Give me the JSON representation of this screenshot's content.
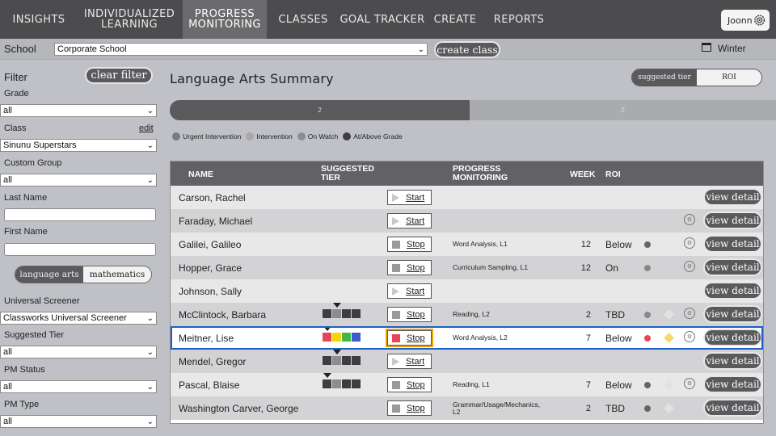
{
  "nav": {
    "items": [
      "INSIGHTS",
      "INDIVIDUALIZED\nLEARNING",
      "PROGRESS\nMONITORING",
      "CLASSES",
      "GOAL TRACKER",
      "CREATE",
      "REPORTS"
    ],
    "active": "PROGRESS\nMONITORING",
    "user": "Joonn"
  },
  "schoolbar": {
    "school_label": "School",
    "school_value": "Corporate School",
    "create_class": "create class",
    "term": "Winter"
  },
  "sidebar": {
    "filter_label": "Filter",
    "clear_filter": "clear filter",
    "grade_label": "Grade",
    "grade_value": "all",
    "class_label": "Class",
    "class_edit": "edit",
    "class_value": "Sinunu Superstars",
    "custom_group_label": "Custom Group",
    "custom_group_value": "all",
    "last_name_label": "Last Name",
    "first_name_label": "First Name",
    "subject_options": [
      "language arts",
      "mathematics"
    ],
    "subject_selected": "language arts",
    "screener_label": "Universal Screener",
    "screener_value": "Classworks Universal Screener",
    "suggested_tier_label": "Suggested Tier",
    "suggested_tier_value": "all",
    "pm_status_label": "PM Status",
    "pm_status_value": "all",
    "pm_type_label": "PM Type",
    "pm_type_value": "all"
  },
  "main": {
    "title": "Language Arts Summary",
    "view_toggle": [
      "suggested tier",
      "ROI"
    ],
    "view_selected": "ROI",
    "bar": [
      {
        "value": "2",
        "fraction": 0.495,
        "color": "#5a5a5d"
      },
      {
        "value": "2",
        "fraction": 0.505,
        "color": "#a9abaf"
      }
    ],
    "legend": [
      {
        "label": "Urgent Intervention",
        "color": "#7a7a7e"
      },
      {
        "label": "Intervention",
        "color": "#a8a8ab"
      },
      {
        "label": "On Watch",
        "color": "#8d8d90"
      },
      {
        "label": "At/Above Grade",
        "color": "#3e3e41"
      }
    ],
    "columns": {
      "name": "NAME",
      "tier": "SUGGESTED\nTIER",
      "pm": "PROGRESS\nMONITORING",
      "week": "WEEK",
      "roi": "ROI"
    },
    "view_detail_label": "view detail",
    "rows": [
      {
        "name": "Carson, Rachel",
        "tier": [],
        "tier_mark": -1,
        "pm_action": "Start",
        "pm_desc": "",
        "week": "",
        "roi": "",
        "dot": "",
        "diamond": "",
        "gear": false
      },
      {
        "name": "Faraday, Michael",
        "tier": [],
        "tier_mark": -1,
        "pm_action": "Start",
        "pm_desc": "",
        "week": "",
        "roi": "",
        "dot": "",
        "diamond": "",
        "gear": true
      },
      {
        "name": "Galilei, Galileo",
        "tier": [],
        "tier_mark": -1,
        "pm_action": "Stop",
        "pm_desc": "Word Analysis, L1",
        "week": "12",
        "roi": "Below",
        "dot": "#666",
        "diamond": "",
        "gear": true
      },
      {
        "name": "Hopper, Grace",
        "tier": [],
        "tier_mark": -1,
        "pm_action": "Stop",
        "pm_desc": "Curriculum Sampling, L1",
        "week": "12",
        "roi": "On",
        "dot": "#888",
        "diamond": "",
        "gear": true
      },
      {
        "name": "Johnson, Sally",
        "tier": [],
        "tier_mark": -1,
        "pm_action": "Start",
        "pm_desc": "",
        "week": "",
        "roi": "",
        "dot": "",
        "diamond": "",
        "gear": false
      },
      {
        "name": "McClintock, Barbara",
        "tier": [
          "#3e3e41",
          "#8d8d90",
          "#3e3e41",
          "#3e3e41"
        ],
        "tier_mark": 1,
        "pm_action": "Stop",
        "pm_desc": "Reading, L2",
        "week": "2",
        "roi": "TBD",
        "dot": "#888",
        "diamond": "#e2e2e2",
        "gear": true
      },
      {
        "name": "Meitner, Lise",
        "tier": [
          "#e8445a",
          "#f5d40a",
          "#3fb84a",
          "#3c5bc8"
        ],
        "tier_mark": 0,
        "pm_action": "Stop",
        "pm_desc": "Word Analysis, L2",
        "week": "7",
        "roi": "Below",
        "dot": "#e8445a",
        "diamond": "#f5d96a",
        "gear": true,
        "selected": true
      },
      {
        "name": "Mendel, Gregor",
        "tier": [
          "#3e3e41",
          "#8d8d90",
          "#3e3e41",
          "#3e3e41"
        ],
        "tier_mark": 1,
        "pm_action": "Start",
        "pm_desc": "",
        "week": "",
        "roi": "",
        "dot": "",
        "diamond": "",
        "gear": false
      },
      {
        "name": "Pascal, Blaise",
        "tier": [
          "#3e3e41",
          "#8d8d90",
          "#3e3e41",
          "#3e3e41"
        ],
        "tier_mark": 0,
        "pm_action": "Stop",
        "pm_desc": "Reading, L1",
        "week": "7",
        "roi": "Below",
        "dot": "#666",
        "diamond": "#e2e2e2",
        "gear": true
      },
      {
        "name": "Washington Carver, George",
        "tier": [],
        "tier_mark": -1,
        "pm_action": "Stop",
        "pm_desc": "Grammar/Usage/Mechanics,\nL2",
        "week": "2",
        "roi": "TBD",
        "dot": "#666",
        "diamond": "#e2e2e2",
        "gear": false
      }
    ]
  }
}
